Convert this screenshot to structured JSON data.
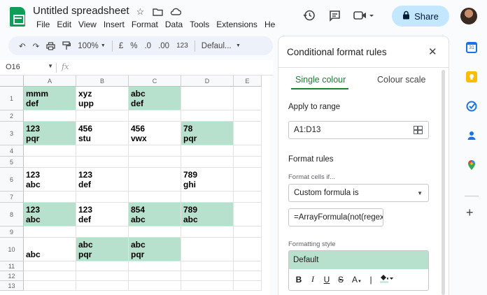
{
  "header": {
    "doc_title": "Untitled spreadsheet",
    "menu": [
      "File",
      "Edit",
      "View",
      "Insert",
      "Format",
      "Data",
      "Tools",
      "Extensions",
      "He"
    ],
    "share_label": "Share"
  },
  "toolbar": {
    "zoom": "100%",
    "currency": "£",
    "percent": "%",
    "dec_decrease": ".0",
    "dec_increase": ".00",
    "number_format": "123",
    "font": "Defaul..."
  },
  "formula_bar": {
    "cell_ref": "O16",
    "fx": "fx"
  },
  "grid": {
    "columns": [
      "A",
      "B",
      "C",
      "D",
      "E"
    ],
    "rows": [
      "1",
      "2",
      "3",
      "4",
      "5",
      "6",
      "7",
      "8",
      "9",
      "10",
      "11",
      "12",
      "13"
    ],
    "cells": {
      "r1": [
        "mmm\ndef",
        "xyz\nupp",
        "abc\ndef",
        "",
        ""
      ],
      "r3": [
        "123\npqr",
        "456\nstu",
        "456\nvwx",
        "78\npqr",
        ""
      ],
      "r6": [
        "123\nabc",
        "123\ndef",
        "",
        "789\nghi",
        ""
      ],
      "r8": [
        "123\nabc",
        "123\ndef",
        "854\nabc",
        "789\nabc",
        ""
      ],
      "r10": [
        "abc",
        "abc\npqr",
        "abc\npqr",
        "",
        ""
      ]
    },
    "highlight_color": "#b7e1cd"
  },
  "panel": {
    "title": "Conditional format rules",
    "tab_single": "Single colour",
    "tab_scale": "Colour scale",
    "apply_label": "Apply to range",
    "range_value": "A1:D13",
    "format_rules_label": "Format rules",
    "format_cells_if": "Format cells if...",
    "condition": "Custom formula is",
    "formula_value": "=ArrayFormula(not(regexm",
    "formatting_style_label": "Formatting style",
    "style_default": "Default",
    "style_tools": [
      "B",
      "I",
      "U",
      "S",
      "A"
    ],
    "accent_color": "#188038"
  },
  "rail": {
    "icons": [
      "calendar-icon",
      "keep-icon",
      "tasks-icon",
      "contacts-icon",
      "maps-icon",
      "add-icon"
    ]
  }
}
